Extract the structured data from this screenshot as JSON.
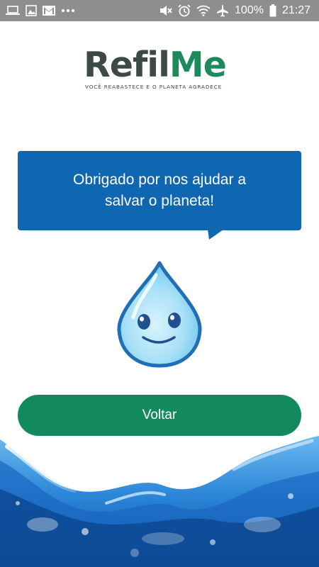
{
  "status_bar": {
    "battery": "100%",
    "time": "21:27",
    "left_icons": [
      "laptop-icon",
      "image-icon",
      "gmail-icon",
      "more-dots-icon"
    ],
    "right_icons": [
      "mute-icon",
      "alarm-icon",
      "wifi-icon",
      "airplane-icon",
      "battery-icon"
    ]
  },
  "logo": {
    "word_part1": "Refil",
    "word_part2": "Me",
    "tagline": "VOCÊ REABASTECE E O PLANETA AGRADECE"
  },
  "message": {
    "line1": "Obrigado por nos ajudar a",
    "line2": "salvar o planeta!"
  },
  "button": {
    "label": "Voltar"
  },
  "colors": {
    "status_bar": "#8e8e8e",
    "bubble": "#1067b1",
    "button": "#128a5e",
    "logo_dark": "#3c4a43",
    "logo_green": "#1e8a5c",
    "droplet_outline": "#1f6fb5",
    "droplet_fill": "#9fdcf6"
  }
}
